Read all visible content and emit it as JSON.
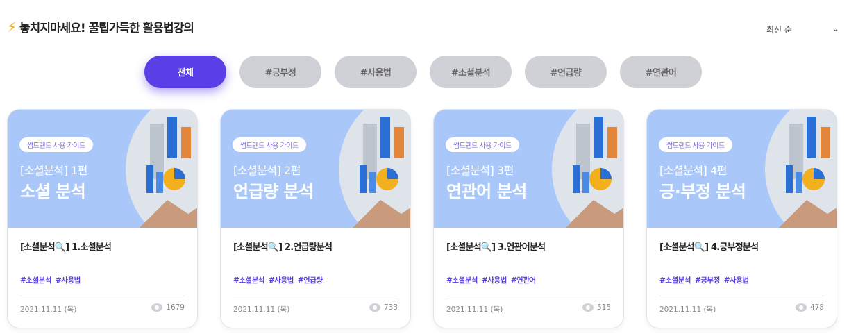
{
  "header": {
    "icon": "lightning-bolt-icon",
    "title": "놓치지마세요! 꿀팁가득한 활용법강의"
  },
  "sort": {
    "selected": "최신 순",
    "icon": "chevron-down-icon"
  },
  "tabs": [
    {
      "label": "전체",
      "active": true
    },
    {
      "label": "#긍부정",
      "active": false
    },
    {
      "label": "#사용법",
      "active": false
    },
    {
      "label": "#소셜분석",
      "active": false
    },
    {
      "label": "#언급량",
      "active": false
    },
    {
      "label": "#연관어",
      "active": false
    }
  ],
  "colors": {
    "accent": "#5b3fe6",
    "thumb_bg": "#a9c8f9",
    "tab_inactive": "#cfd1d6"
  },
  "cards": [
    {
      "badge": "썸트렌드 사용 가이드",
      "series": "[소셜분석] 1편",
      "big": "소셜 분석",
      "title": "[소셜분석🔍] 1.소셜분석",
      "tags": [
        "#소셜분석",
        "#사용법"
      ],
      "date": "2021.11.11 (목)",
      "views": "1679"
    },
    {
      "badge": "썸트렌드 사용 가이드",
      "series": "[소셜분석] 2편",
      "big": "언급량 분석",
      "title": "[소셜분석🔍] 2.언급량분석",
      "tags": [
        "#소셜분석",
        "#사용법",
        "#언급량"
      ],
      "date": "2021.11.11 (목)",
      "views": "733"
    },
    {
      "badge": "썸트렌드 사용 가이드",
      "series": "[소셜분석] 3편",
      "big": "연관어 분석",
      "title": "[소셜분석🔍] 3.연관어분석",
      "tags": [
        "#소셜분석",
        "#사용법",
        "#연관어"
      ],
      "date": "2021.11.11 (목)",
      "views": "515"
    },
    {
      "badge": "썸트렌드 사용 가이드",
      "series": "[소셜분석] 4편",
      "big": "긍·부정 분석",
      "title": "[소셜분석🔍] 4.긍부정분석",
      "tags": [
        "#소셜분석",
        "#긍부정",
        "#사용법"
      ],
      "date": "2021.11.11 (목)",
      "views": "478"
    }
  ]
}
